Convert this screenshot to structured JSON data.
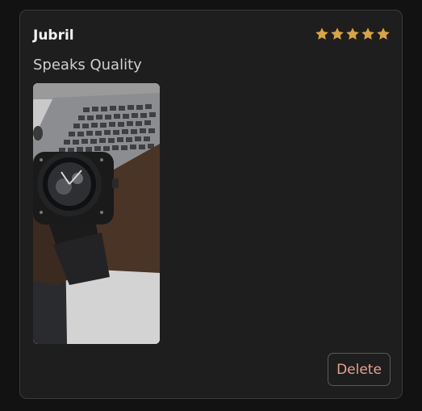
{
  "review": {
    "reviewer_name": "Jubril",
    "rating": 5,
    "rating_max": 5,
    "text": "Speaks Quality",
    "photo_icon": "watch-photo"
  },
  "actions": {
    "delete_label": "Delete"
  },
  "colors": {
    "background": "#121212",
    "card": "#1e1e1e",
    "star": "#d9a441",
    "delete_text": "#e8a08f"
  }
}
